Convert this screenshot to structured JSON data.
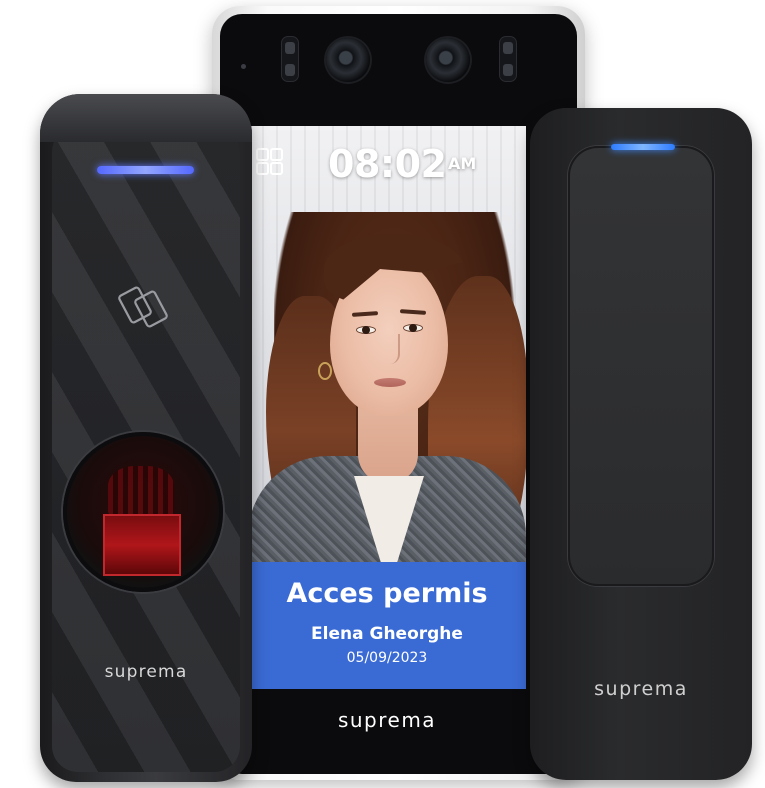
{
  "terminal": {
    "clock": {
      "time": "08:02",
      "ampm": "AM"
    },
    "banner": {
      "title": "Acces permis",
      "name": "Elena Gheorghe",
      "date": "05/09/2023",
      "color": "#3a6bd4"
    },
    "brand": "suprema",
    "menu_icon": "grid-menu-icon"
  },
  "fingerprint_reader": {
    "brand": "suprema",
    "led_color": "#6a82ff",
    "card_icon": "contactless-card-icon",
    "sensor_color": "#b0161a"
  },
  "card_reader": {
    "brand": "suprema",
    "led_color": "#3d8cff"
  }
}
